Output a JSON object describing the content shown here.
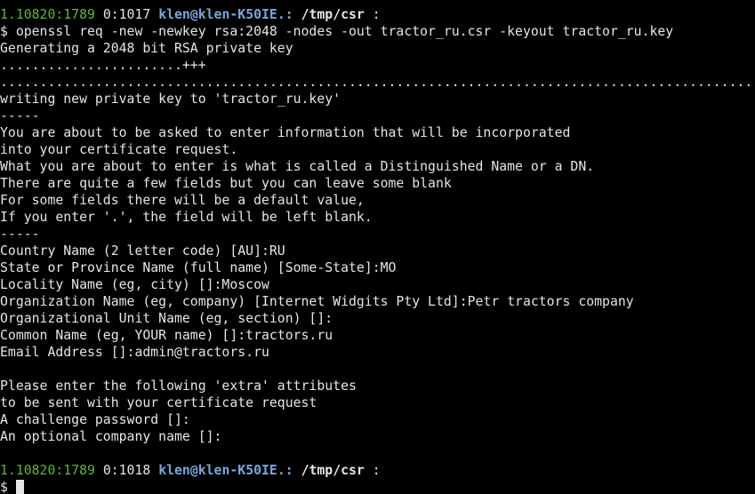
{
  "colors": {
    "background": "#000000",
    "text": "#e5e5e5",
    "prompt_counter": "#65b33a",
    "prompt_user_host": "#7aa6da"
  },
  "prompts": [
    {
      "counter": "1.10820:1789",
      "time": "0:1017",
      "user_host": "klen@klen-K50IE.:",
      "path": "/tmp/csr",
      "separator": ":"
    },
    {
      "counter": "1.10820:1789",
      "time": "0:1018",
      "user_host": "klen@klen-K50IE.:",
      "path": "/tmp/csr",
      "separator": ":"
    }
  ],
  "command": "$ openssl req -new -newkey rsa:2048 -nodes -out tractor_ru.csr -keyout tractor_ru.key",
  "output": [
    "Generating a 2048 bit RSA private key",
    ".......................+++",
    "........................................................................................................+++",
    "writing new private key to 'tractor_ru.key'",
    "-----",
    "You are about to be asked to enter information that will be incorporated",
    "into your certificate request.",
    "What you are about to enter is what is called a Distinguished Name or a DN.",
    "There are quite a few fields but you can leave some blank",
    "For some fields there will be a default value,",
    "If you enter '.', the field will be left blank.",
    "-----",
    "Country Name (2 letter code) [AU]:RU",
    "State or Province Name (full name) [Some-State]:MO",
    "Locality Name (eg, city) []:Moscow",
    "Organization Name (eg, company) [Internet Widgits Pty Ltd]:Petr tractors company",
    "Organizational Unit Name (eg, section) []:",
    "Common Name (eg, YOUR name) []:tractors.ru",
    "Email Address []:admin@tractors.ru",
    "",
    "Please enter the following 'extra' attributes",
    "to be sent with your certificate request",
    "A challenge password []:",
    "An optional company name []:",
    ""
  ],
  "final_prompt_symbol": "$"
}
